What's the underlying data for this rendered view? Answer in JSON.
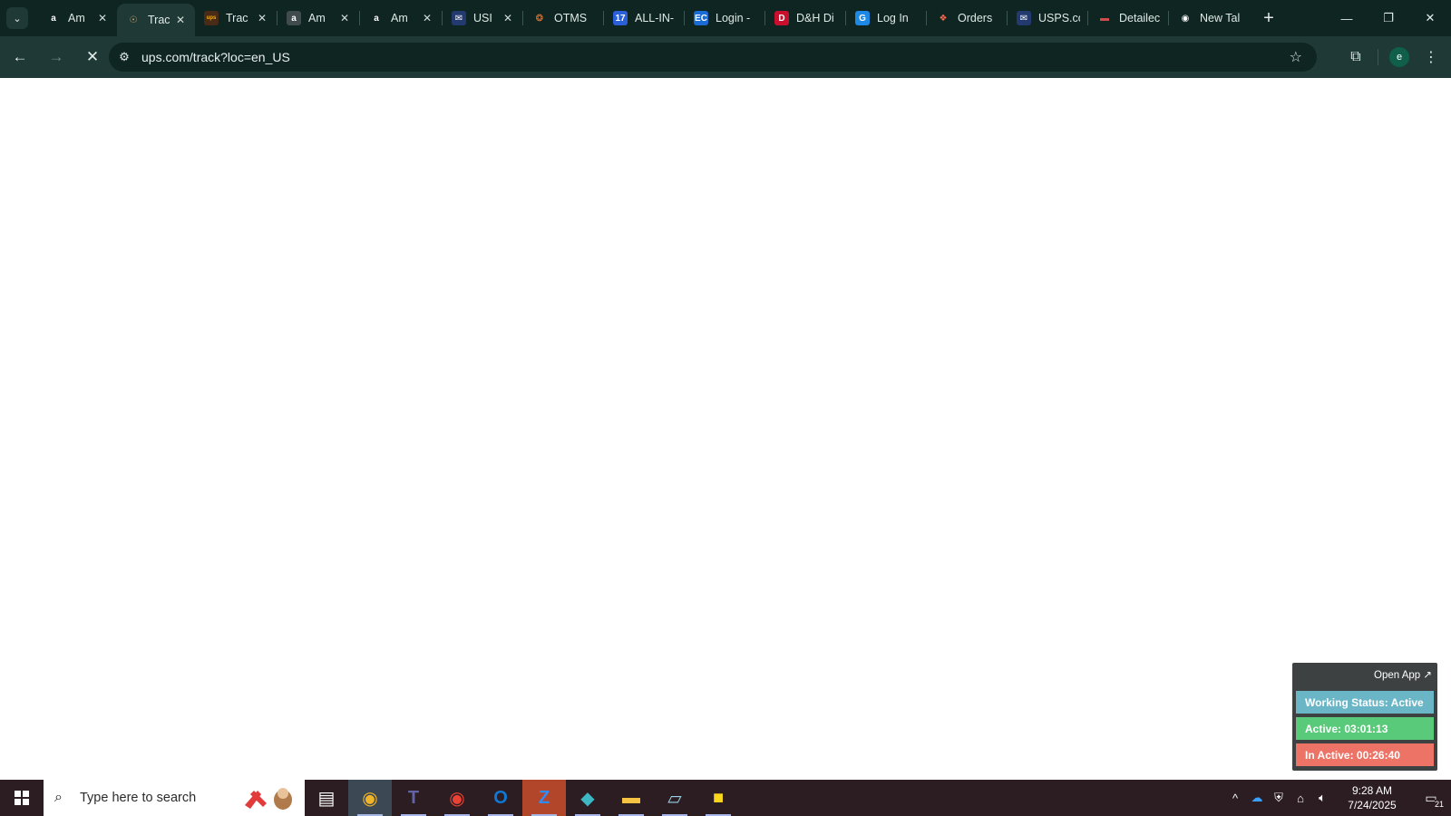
{
  "browser": {
    "tab_search_icon": "chevron-down-icon",
    "tabs": [
      {
        "title": "Am",
        "icon": "amazon-icon",
        "color": "#ffffff",
        "bg": "#0f2522",
        "glyph": "a",
        "closable": true,
        "active": false,
        "width": 88
      },
      {
        "title": "Trac",
        "icon": "ups-tracking-icon",
        "color": "#d7a56b",
        "bg": "#1f3a36",
        "glyph": "☉",
        "closable": true,
        "active": true,
        "width": 86
      },
      {
        "title": "Trac",
        "icon": "ups-icon",
        "color": "#f2b01e",
        "bg": "#4a2b16",
        "glyph": "ups",
        "closable": true,
        "active": false,
        "width": 90
      },
      {
        "title": "Am",
        "icon": "amazon-icon",
        "color": "#ffffff",
        "bg": "#3f4b4c",
        "glyph": "a",
        "closable": true,
        "active": false,
        "width": 90
      },
      {
        "title": "Am",
        "icon": "amazon-icon",
        "color": "#ffffff",
        "bg": "#0f2522",
        "glyph": "a",
        "closable": true,
        "active": false,
        "width": 90
      },
      {
        "title": "USI",
        "icon": "usps-icon",
        "color": "#ffffff",
        "bg": "#233a70",
        "glyph": "✉",
        "closable": true,
        "active": false,
        "width": 88
      },
      {
        "title": "OTMS",
        "icon": "otms-icon",
        "color": "#ff7a2a",
        "bg": "#0f2522",
        "glyph": "❂",
        "closable": false,
        "active": false,
        "width": 88
      },
      {
        "title": "ALL-IN-",
        "icon": "seventeen-track-icon",
        "color": "#ffffff",
        "bg": "#2a5fd8",
        "glyph": "17",
        "closable": false,
        "active": false,
        "width": 88
      },
      {
        "title": "Login -",
        "icon": "ec-icon",
        "color": "#ffffff",
        "bg": "#1a6bd6",
        "glyph": "EC",
        "closable": false,
        "active": false,
        "width": 88
      },
      {
        "title": "D&H Di",
        "icon": "dh-icon",
        "color": "#ffffff",
        "bg": "#c8102e",
        "glyph": "D",
        "closable": false,
        "active": false,
        "width": 88
      },
      {
        "title": "Log In",
        "icon": "login-g-icon",
        "color": "#ffffff",
        "bg": "#1e88e5",
        "glyph": "G",
        "closable": false,
        "active": false,
        "width": 88
      },
      {
        "title": "Orders",
        "icon": "orders-icon",
        "color": "#ff6a4d",
        "bg": "#0f2522",
        "glyph": "❖",
        "closable": false,
        "active": false,
        "width": 88
      },
      {
        "title": "USPS.co",
        "icon": "usps-icon",
        "color": "#ffffff",
        "bg": "#233a70",
        "glyph": "✉",
        "closable": false,
        "active": false,
        "width": 88
      },
      {
        "title": "Detailec",
        "icon": "flag-icon",
        "color": "#d14b4b",
        "bg": "#0f2522",
        "glyph": "▬",
        "closable": false,
        "active": false,
        "width": 88
      },
      {
        "title": "New Tal",
        "icon": "chrome-icon",
        "color": "#ffffff",
        "bg": "#0f2522",
        "glyph": "◉",
        "closable": false,
        "active": false,
        "width": 90
      }
    ],
    "new_tab_label": "+",
    "window_controls": {
      "minimize": "—",
      "restore": "❐",
      "close": "✕"
    },
    "toolbar": {
      "back": "←",
      "forward": "→",
      "reload": "✕",
      "url": "ups.com/track?loc=en_US",
      "profile_initial": "e"
    }
  },
  "tracker_widget": {
    "open_app": "Open App ↗",
    "working_status": "Working Status: Active",
    "active_time": "Active: 03:01:13",
    "inactive_time": "In Active: 00:26:40"
  },
  "taskbar": {
    "search_placeholder": "Type here to search",
    "apps": [
      {
        "name": "task-view-icon",
        "glyph": "▤",
        "color": "#ffffff",
        "running": false
      },
      {
        "name": "chrome-icon",
        "glyph": "◉",
        "color": "#f0b429",
        "running": true,
        "active": true
      },
      {
        "name": "teams-icon",
        "glyph": "T",
        "color": "#6264a7",
        "running": true
      },
      {
        "name": "chrome-profile-icon",
        "glyph": "◉",
        "color": "#e94235",
        "running": true
      },
      {
        "name": "outlook-icon",
        "glyph": "O",
        "color": "#0f78d4",
        "running": true
      },
      {
        "name": "zoom-icon",
        "glyph": "Z",
        "color": "#2d8cff",
        "running": true,
        "zoom": true
      },
      {
        "name": "kite-app-icon",
        "glyph": "◆",
        "color": "#3db7c4",
        "running": true
      },
      {
        "name": "file-explorer-icon",
        "glyph": "▬",
        "color": "#f6c343",
        "running": true
      },
      {
        "name": "notepad-icon",
        "glyph": "▱",
        "color": "#9ad0e6",
        "running": true
      },
      {
        "name": "sticky-notes-icon",
        "glyph": "■",
        "color": "#f9d71c",
        "running": true
      }
    ],
    "time": "9:28 AM",
    "date": "7/24/2025",
    "notification_count": "21"
  }
}
